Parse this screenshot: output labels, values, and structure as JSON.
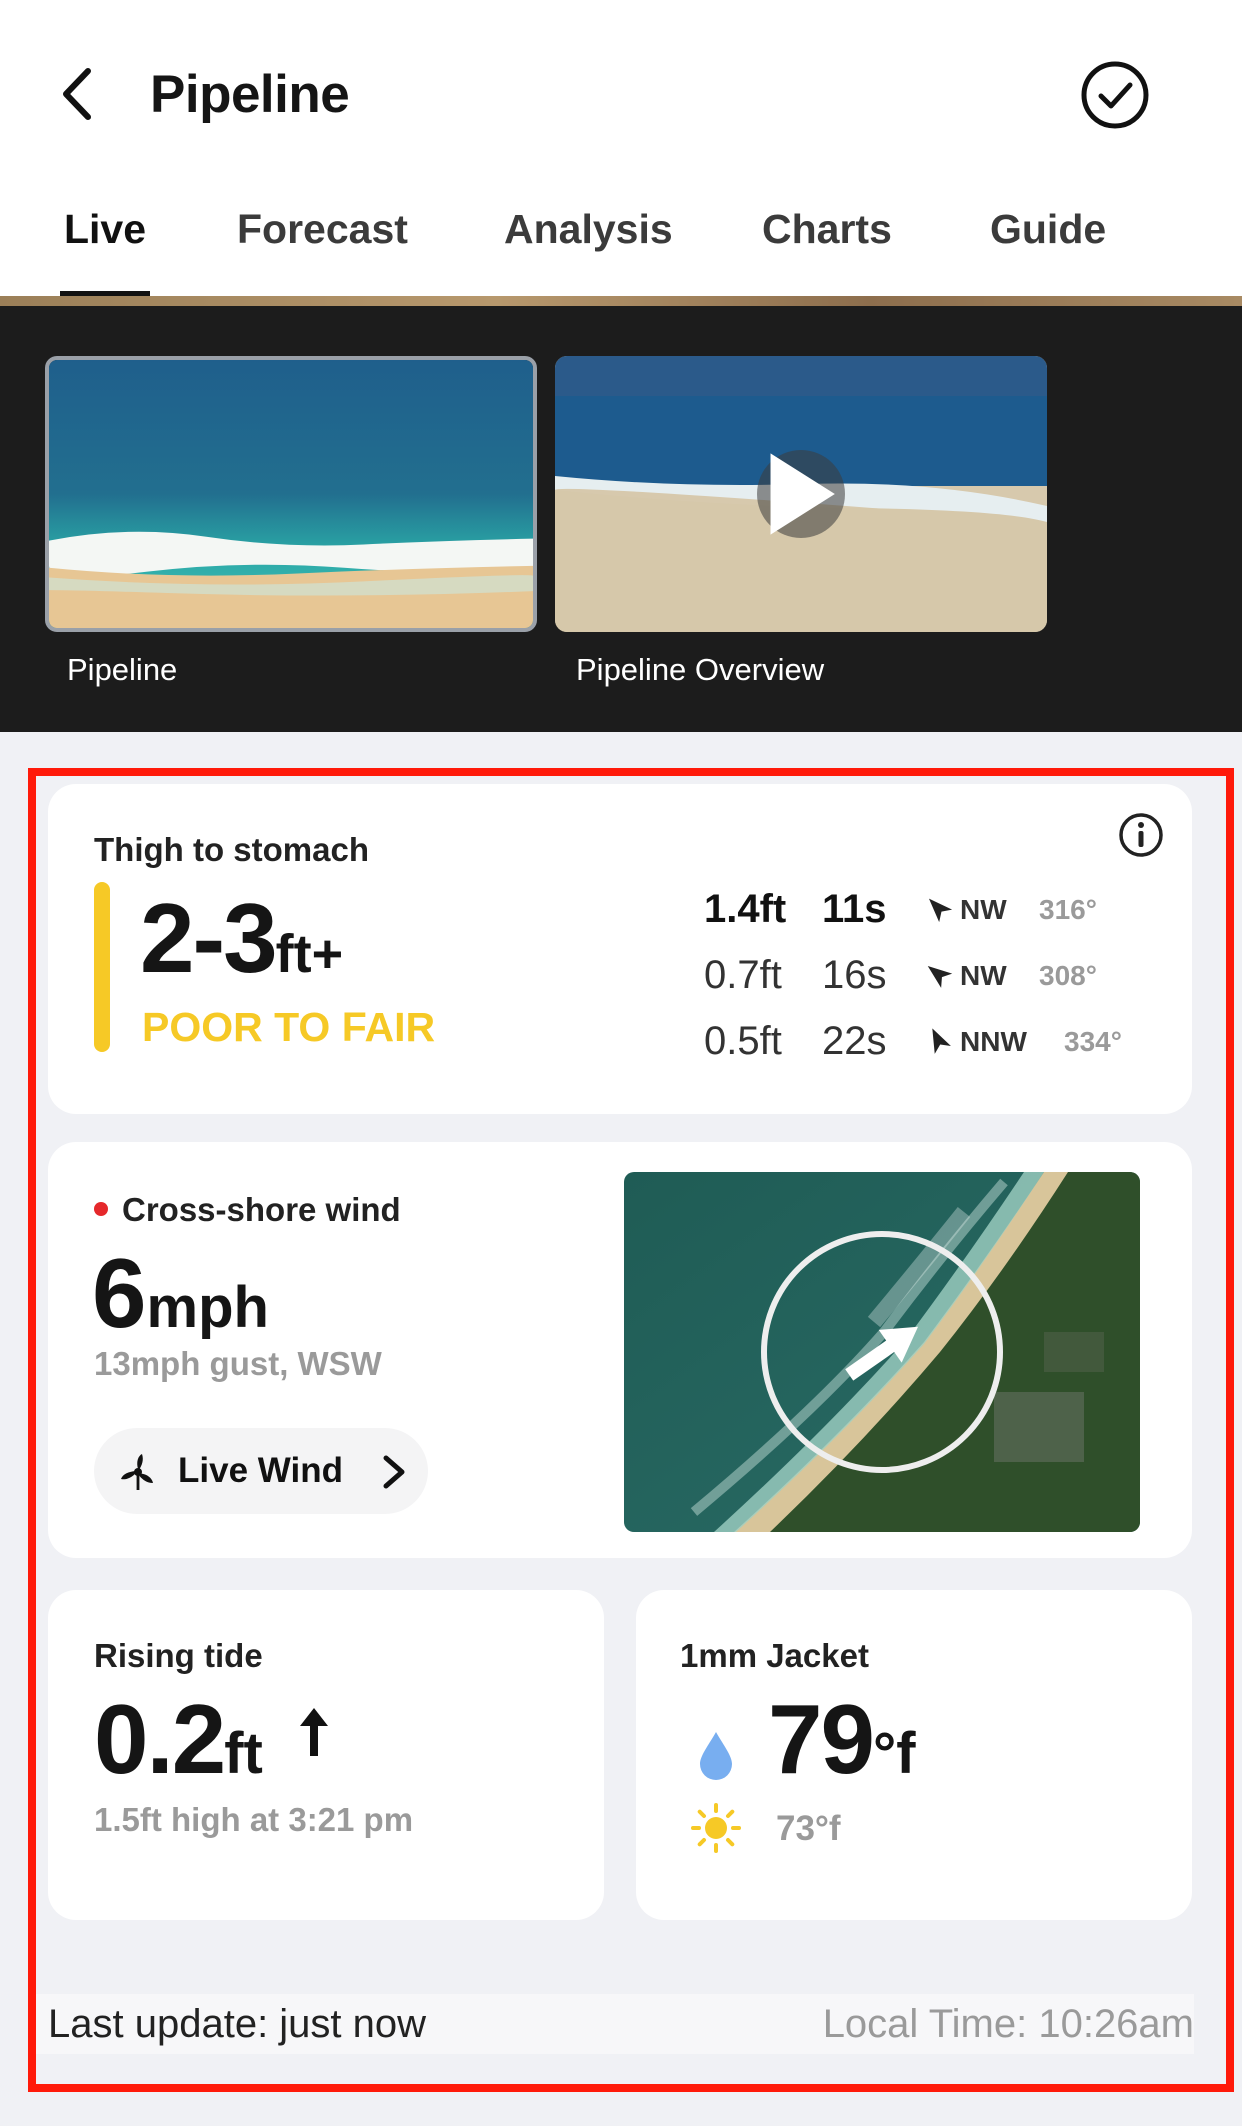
{
  "header": {
    "title": "Pipeline",
    "tabs": [
      "Live",
      "Forecast",
      "Analysis",
      "Charts",
      "Guide"
    ],
    "active_tab": "Live"
  },
  "cams": [
    {
      "label": "Pipeline"
    },
    {
      "label": "Pipeline Overview"
    }
  ],
  "surf": {
    "description": "Thigh to stomach",
    "height": "2-3",
    "height_unit": "ft+",
    "rating": "POOR TO FAIR",
    "rating_color": "#f6c926",
    "swells": [
      {
        "height": "1.4ft",
        "period": "11s",
        "direction": "NW",
        "degrees": "316°"
      },
      {
        "height": "0.7ft",
        "period": "16s",
        "direction": "NW",
        "degrees": "308°"
      },
      {
        "height": "0.5ft",
        "period": "22s",
        "direction": "NNW",
        "degrees": "334°"
      }
    ]
  },
  "wind": {
    "label": "Cross-shore wind",
    "speed": "6",
    "unit": "mph",
    "gust": "13mph gust, WSW",
    "live_wind_label": "Live Wind"
  },
  "tide": {
    "label": "Rising tide",
    "value": "0.2",
    "unit": "ft",
    "sub": "1.5ft high at 3:21 pm"
  },
  "temperature": {
    "label": "1mm Jacket",
    "water": "79",
    "water_unit": "°f",
    "air": "73°f"
  },
  "footer": {
    "last_update": "Last update: just now",
    "local_time": "Local Time: 10:26am"
  },
  "colors": {
    "highlight_frame": "#ff1a0a",
    "wind_dot": "#e5282b"
  }
}
